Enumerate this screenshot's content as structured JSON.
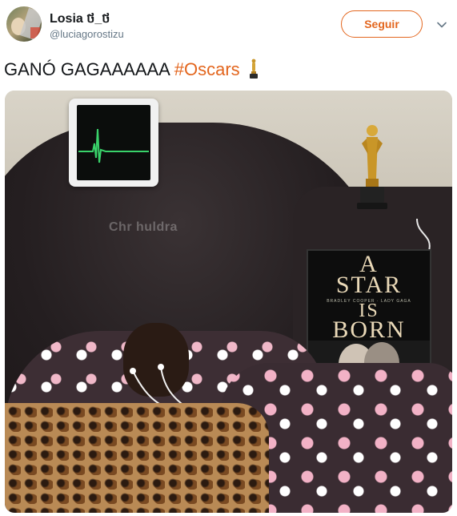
{
  "tweet": {
    "author": {
      "name": "Losia ថ_ថ",
      "handle": "@luciagorostizu"
    },
    "follow_label": "Seguir",
    "text_plain": "GANÓ GAGAAAAAA",
    "hashtag": "#Oscars"
  },
  "image": {
    "watermark": "Chr huldra",
    "poster": {
      "title_line1": "A",
      "title_line2": "STAR",
      "title_line3": "IS",
      "title_line4": "BORN",
      "credits": "BRADLEY COOPER · LADY GAGA"
    }
  },
  "icons": {
    "caret": "chevron-down-icon",
    "oscar": "oscar-trophy-icon"
  },
  "colors": {
    "accent": "#e3661e",
    "text": "#14171a",
    "secondary": "#657786"
  }
}
